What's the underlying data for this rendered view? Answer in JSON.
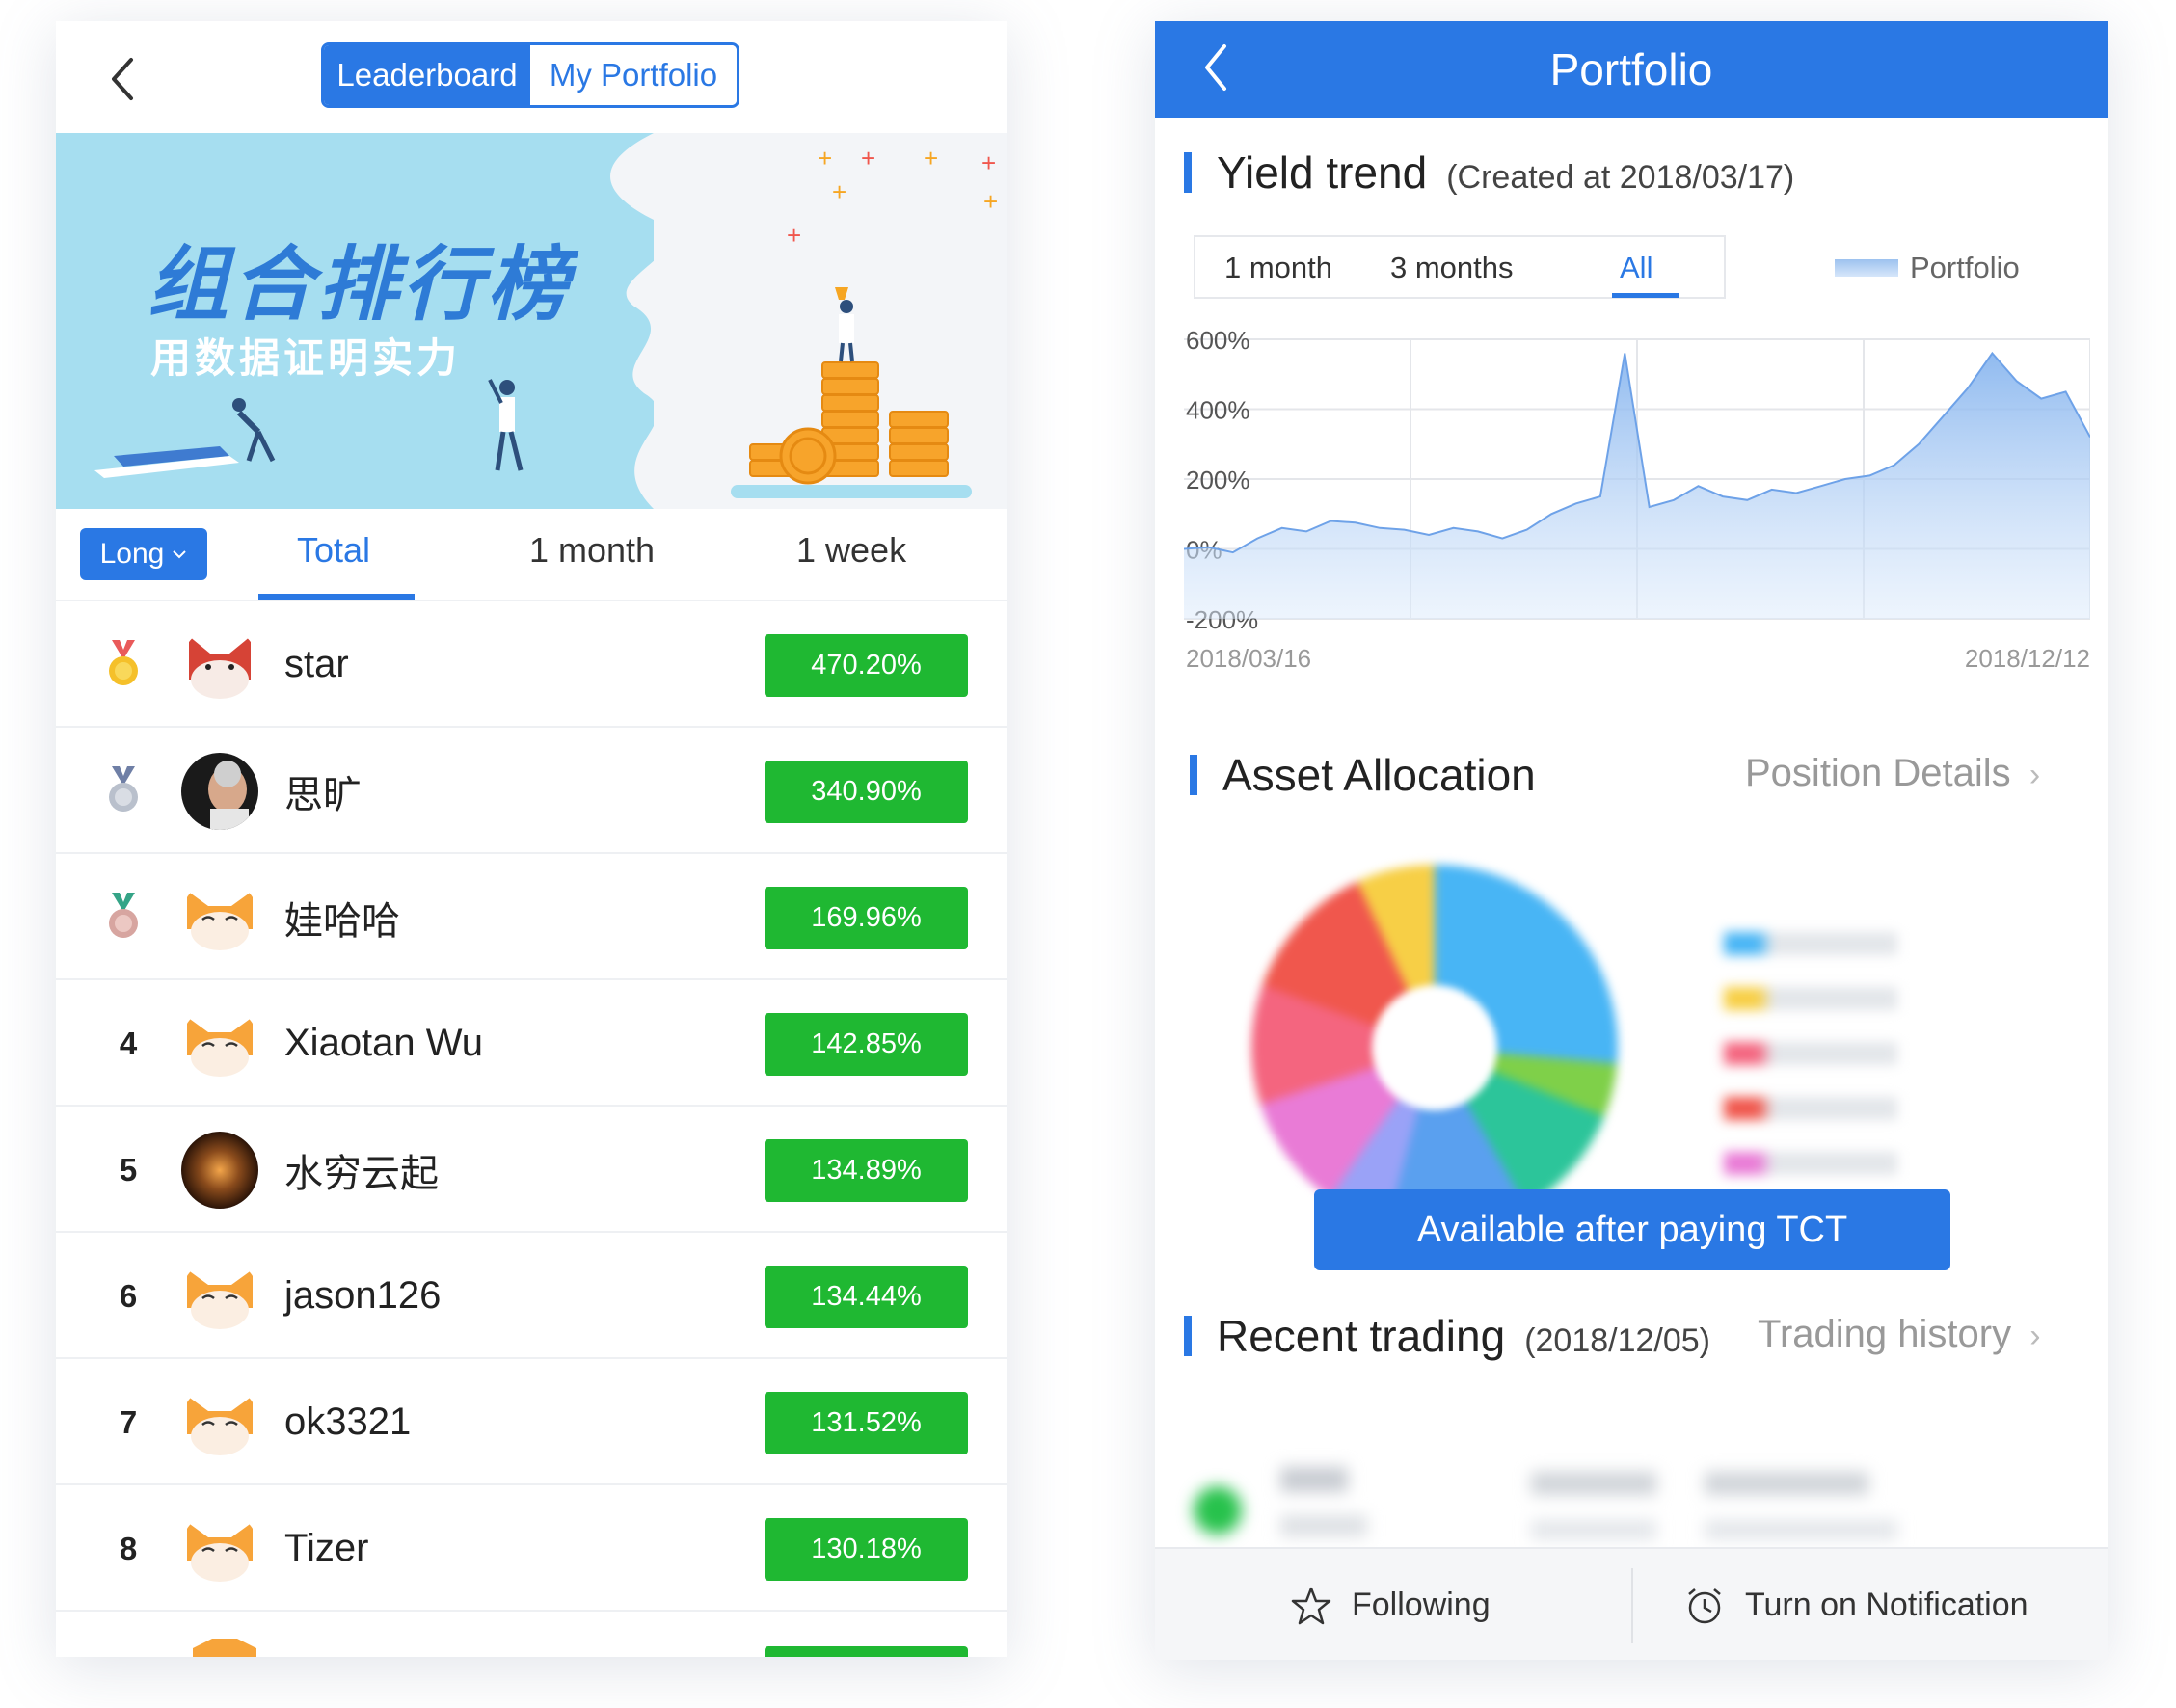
{
  "left": {
    "segment": {
      "leaderboard": "Leaderboard",
      "my_portfolio": "My Portfolio"
    },
    "banner": {
      "title": "组合排行榜",
      "subtitle": "用数据证明实力"
    },
    "filters": {
      "long_label": "Long",
      "tabs": [
        "Total",
        "1 month",
        "1 week"
      ],
      "active_tab": "Total"
    },
    "ranking": [
      {
        "rank": "1",
        "name": "star",
        "pct": "470.20%",
        "medal": "gold"
      },
      {
        "rank": "2",
        "name": "思旷",
        "pct": "340.90%",
        "medal": "silver"
      },
      {
        "rank": "3",
        "name": "娃哈哈",
        "pct": "169.96%",
        "medal": "bronze"
      },
      {
        "rank": "4",
        "name": "Xiaotan Wu",
        "pct": "142.85%"
      },
      {
        "rank": "5",
        "name": "水穷云起",
        "pct": "134.89%"
      },
      {
        "rank": "6",
        "name": "jason126",
        "pct": "134.44%"
      },
      {
        "rank": "7",
        "name": "ok3321",
        "pct": "131.52%"
      },
      {
        "rank": "8",
        "name": "Tizer",
        "pct": "130.18%"
      }
    ],
    "colors": {
      "accent": "#2a78e4",
      "gain": "#1fb832",
      "banner": "#a6def0"
    }
  },
  "right": {
    "title": "Portfolio",
    "yield": {
      "title": "Yield trend",
      "created": "(Created at 2018/03/17)",
      "ranges": [
        "1 month",
        "3 months",
        "All"
      ],
      "active_range": "All",
      "legend": "Portfolio"
    },
    "chart_data": {
      "type": "area",
      "series": [
        {
          "name": "Portfolio",
          "values": [
            0,
            5,
            -10,
            30,
            60,
            50,
            80,
            75,
            60,
            55,
            40,
            60,
            50,
            30,
            55,
            100,
            130,
            150,
            560,
            120,
            140,
            180,
            150,
            140,
            170,
            160,
            180,
            200,
            210,
            240,
            300,
            380,
            460,
            560,
            480,
            430,
            450,
            320
          ]
        }
      ],
      "x_labels": [
        "2018/03/16",
        "2018/12/12"
      ],
      "y_ticks": [
        "600%",
        "400%",
        "200%",
        "0%",
        "-200%"
      ],
      "ylim": [
        -200,
        600
      ],
      "grid": true,
      "legend_position": "top-right"
    },
    "asset": {
      "title": "Asset Allocation",
      "link": "Position Details",
      "pay_button": "Available after paying TCT"
    },
    "trading": {
      "title": "Recent trading",
      "date": "(2018/12/05)",
      "link": "Trading history"
    },
    "bottom": {
      "following": "Following",
      "notify": "Turn on Notification"
    }
  }
}
